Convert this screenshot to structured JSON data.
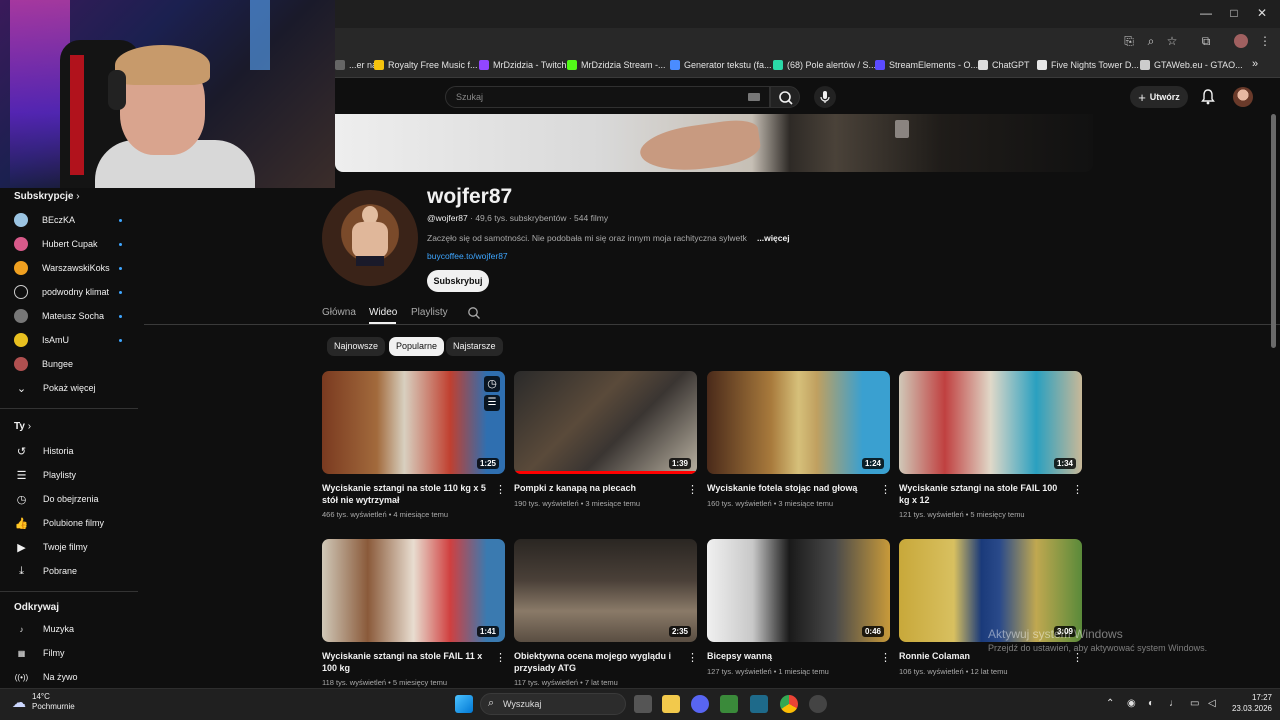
{
  "browser": {
    "window_controls": {
      "minimize": "—",
      "maximize": "□",
      "close": "✕"
    },
    "bookmarks": [
      {
        "label": "...er na...",
        "color": "#666"
      },
      {
        "label": "Royalty Free Music f...",
        "color": "#f4c20d"
      },
      {
        "label": "MrDzidzia - Twitch",
        "color": "#9146ff"
      },
      {
        "label": "MrDzidzia Stream -...",
        "color": "#53fc18"
      },
      {
        "label": "Generator tekstu (fa...",
        "color": "#4a8cff"
      },
      {
        "label": "(68) Pole alertów / S...",
        "color": "#2bd9a8"
      },
      {
        "label": "StreamElements - O...",
        "color": "#5b4bff"
      },
      {
        "label": "ChatGPT",
        "color": "#dddddd"
      },
      {
        "label": "Five Nights Tower D...",
        "color": "#e8e8e8"
      },
      {
        "label": "GTAWeb.eu - GTAO...",
        "color": "#cccccc"
      }
    ],
    "more": "»"
  },
  "youtube": {
    "search_placeholder": "Szukaj",
    "create_label": "Utwórz"
  },
  "sidebar": {
    "subs_header": "Subskrypcje",
    "subscriptions": [
      {
        "name": "BEczKA",
        "color": "#9bc4e2",
        "live": true
      },
      {
        "name": "Hubert Cupak",
        "color": "#d85a8a",
        "live": true
      },
      {
        "name": "WarszawskiKoks",
        "color": "#f0a020",
        "live": true
      },
      {
        "name": "podwodny klimat",
        "color": "#0f0f0f",
        "live": true
      },
      {
        "name": "Mateusz Socha",
        "color": "#777777",
        "live": true
      },
      {
        "name": "IsAmU",
        "color": "#e8c020",
        "live": true
      },
      {
        "name": "Bungee",
        "color": "#b05050",
        "live": false
      }
    ],
    "show_more": "Pokaż więcej",
    "you_header": "Ty",
    "you_items": [
      {
        "label": "Historia",
        "icon": "history-icon"
      },
      {
        "label": "Playlisty",
        "icon": "playlist-icon"
      },
      {
        "label": "Do obejrzenia",
        "icon": "watch-later-icon"
      },
      {
        "label": "Polubione filmy",
        "icon": "like-icon"
      },
      {
        "label": "Twoje filmy",
        "icon": "your-videos-icon"
      },
      {
        "label": "Pobrane",
        "icon": "download-icon"
      }
    ],
    "explore_header": "Odkrywaj",
    "explore_items": [
      {
        "label": "Muzyka",
        "icon": "music-icon"
      },
      {
        "label": "Filmy",
        "icon": "movies-icon"
      },
      {
        "label": "Na żywo",
        "icon": "live-icon"
      }
    ]
  },
  "channel": {
    "name": "wojfer87",
    "handle": "@wojfer87",
    "meta_rest": " · 49,6 tys. subskrybentów · 544 filmy",
    "description": "Zaczęło się od samotności. Nie podobała mi się oraz innym moja rachityczna sylwetk",
    "more": "...więcej",
    "link": "buycoffee.to/wojfer87",
    "subscribe": "Subskrybuj"
  },
  "tabs": [
    "Główna",
    "Wideo",
    "Playlisty"
  ],
  "active_tab": "Wideo",
  "chips": [
    "Najnowsze",
    "Popularne",
    "Najstarsze"
  ],
  "active_chip": "Popularne",
  "videos": [
    {
      "title": "Wyciskanie sztangi na stole 110 kg x 5 stół nie wytrzymał",
      "views": "466 tys. wyświetleń",
      "age": "4 miesiące temu",
      "duration": "1:25",
      "bg": "linear-gradient(90deg,#7a3a20 0%,#a26a3c 30%,#d8d0c0 45%,#c04030 70%,#2f6fb0 90%)"
    },
    {
      "title": "Pompki z kanapą na plecach",
      "views": "190 tys. wyświetleń",
      "age": "3 miesiące temu",
      "duration": "1:39",
      "bg": "linear-gradient(135deg,#2a2a2a 0%,#5a4a3a 40%,#3a3532 60%,#b8b0a0 100%)"
    },
    {
      "title": "Wyciskanie fotela stojąc nad głową",
      "views": "160 tys. wyświetleń",
      "age": "3 miesiące temu",
      "duration": "1:24",
      "bg": "linear-gradient(90deg,#4a2a1a 0%,#a87a3c 35%,#d6c07a 50%,#c0a060 60%,#3aa0d0 85%)"
    },
    {
      "title": "Wyciskanie sztangi na stole FAIL 100 kg x 12",
      "views": "121 tys. wyświetleń",
      "age": "5 miesięcy temu",
      "duration": "1:34",
      "bg": "linear-gradient(90deg,#d0c8b8 0%,#c04040 25%,#e0d8c8 50%,#2aa0c0 75%,#c8b898 100%)"
    },
    {
      "title": "Wyciskanie sztangi na stole FAIL 11 x 100 kg",
      "views": "118 tys. wyświetleń",
      "age": "5 miesięcy temu",
      "duration": "1:41",
      "bg": "linear-gradient(90deg,#d0c8b8 0%,#8a5a3a 25%,#e8ddd0 50%,#d04040 70%,#3a7ab0 90%)"
    },
    {
      "title": "Obiektywna ocena mojego wyglądu i przysiady ATG",
      "views": "117 tys. wyświetleń",
      "age": "7 lat temu",
      "duration": "2:35",
      "bg": "linear-gradient(180deg,#2a2622 0%,#4a4038 40%,#8a7a68 70%,#5a4e42 100%)"
    },
    {
      "title": "Bicepsy wanną",
      "views": "127 tys. wyświetleń",
      "age": "1 miesiąc temu",
      "duration": "0:46",
      "bg": "linear-gradient(90deg,#f0f0f0 0%,#c8c8c8 25%,#1a1a1a 45%,#4a4a4a 70%,#c89a3a 100%)"
    },
    {
      "title": "Ronnie Colaman",
      "views": "106 tys. wyświetleń",
      "age": "12 lat temu",
      "duration": "3:09",
      "bg": "linear-gradient(90deg,#c8a83a 0%,#d8c060 30%,#1a3a7a 45%,#2a4a8a 55%,#c0a850 75%,#5a8a3a 100%)"
    }
  ],
  "watermark": {
    "line1": "Aktywuj system Windows",
    "line2": "Przejdź do ustawień, aby aktywować system Windows."
  },
  "taskbar": {
    "temp": "14°C",
    "weather": "Pochmurnie",
    "search": "Wyszukaj",
    "time": "17:27",
    "date": "23.03.2026"
  }
}
